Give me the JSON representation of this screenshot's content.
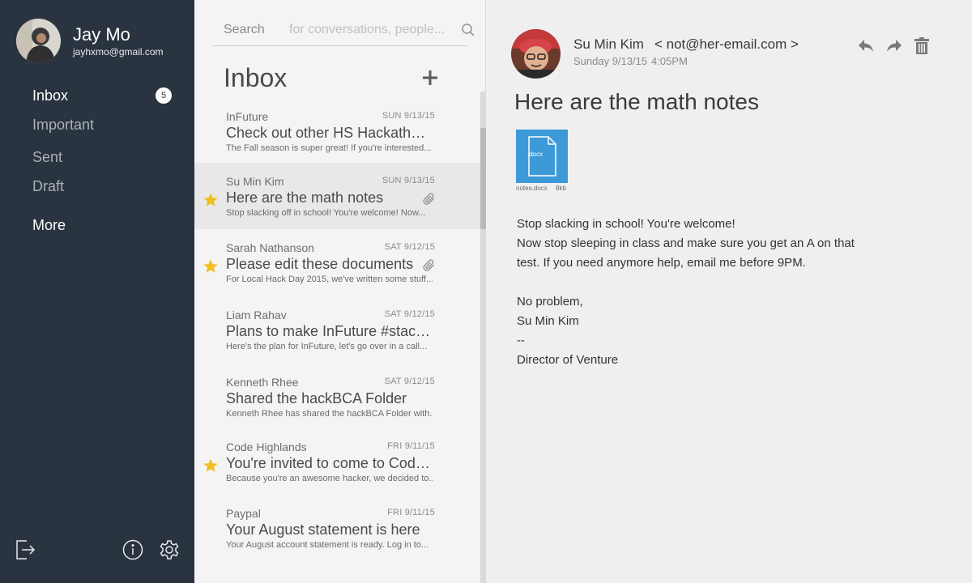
{
  "profile": {
    "name": "Jay Mo",
    "email": "jayhxmo@gmail.com"
  },
  "nav": {
    "inbox": "Inbox",
    "inbox_count": "5",
    "important": "Important",
    "sent": "Sent",
    "draft": "Draft",
    "more": "More"
  },
  "footer": {
    "logout_icon": "logout-icon",
    "info_icon": "info-icon",
    "settings_icon": "gear-icon"
  },
  "search": {
    "label": "Search",
    "placeholder": "for conversations, people..."
  },
  "list": {
    "title": "Inbox",
    "items": [
      {
        "sender": "InFuture",
        "date": "SUN 9/13/15",
        "subject": "Check out other HS Hackathons",
        "preview": "The Fall season is super great!  If you're interested...",
        "starred": false,
        "attachment": false,
        "selected": false
      },
      {
        "sender": "Su Min Kim",
        "date": "SUN 9/13/15",
        "subject": "Here are the math notes",
        "preview": "Stop slacking off in school! You're welcome! Now...",
        "starred": true,
        "attachment": true,
        "selected": true
      },
      {
        "sender": "Sarah Nathanson",
        "date": "SAT 9/12/15",
        "subject": "Please edit these documents",
        "preview": "For Local Hack Day 2015, we've written some stuff...",
        "starred": true,
        "attachment": true,
        "selected": false
      },
      {
        "sender": "Liam Rahav",
        "date": "SAT 9/12/15",
        "subject": "Plans to make InFuture #stacked",
        "preview": "Here's the plan for InFuture, let's go over in a call...",
        "starred": false,
        "attachment": false,
        "selected": false
      },
      {
        "sender": "Kenneth Rhee",
        "date": "SAT 9/12/15",
        "subject": "Shared the hackBCA Folder",
        "preview": "Kenneth Rhee has shared the hackBCA Folder with...",
        "starred": false,
        "attachment": false,
        "selected": false
      },
      {
        "sender": "Code Highlands",
        "date": "FRI 9/11/15",
        "subject": "You're invited to come to Code...",
        "preview": "Because you're an awesome hacker, we decided to...",
        "starred": true,
        "attachment": false,
        "selected": false
      },
      {
        "sender": "Paypal",
        "date": "FRI 9/11/15",
        "subject": "Your August statement is here",
        "preview": "Your August account statement is ready. Log in to...",
        "starred": false,
        "attachment": false,
        "selected": false
      }
    ]
  },
  "message": {
    "from_name": "Su Min Kim",
    "from_email": "< not@her-email.com >",
    "day": "Sunday 9/13/15",
    "time": "4:05PM",
    "subject": "Here are the math notes",
    "attachment": {
      "ext": ".docx",
      "name": "notes.docx",
      "size": "8kb"
    },
    "body": [
      "Stop slacking in school! You're welcome!",
      "Now stop sleeping in class and make sure you get an A on that",
      "test. If you need anymore help, email me before 9PM.",
      "",
      "No problem,",
      "Su Min Kim",
      "--",
      "Director of Venture"
    ]
  },
  "colors": {
    "sidebar": "#2a3440",
    "accent": "#3d9ad9",
    "star": "#f2c01e"
  }
}
